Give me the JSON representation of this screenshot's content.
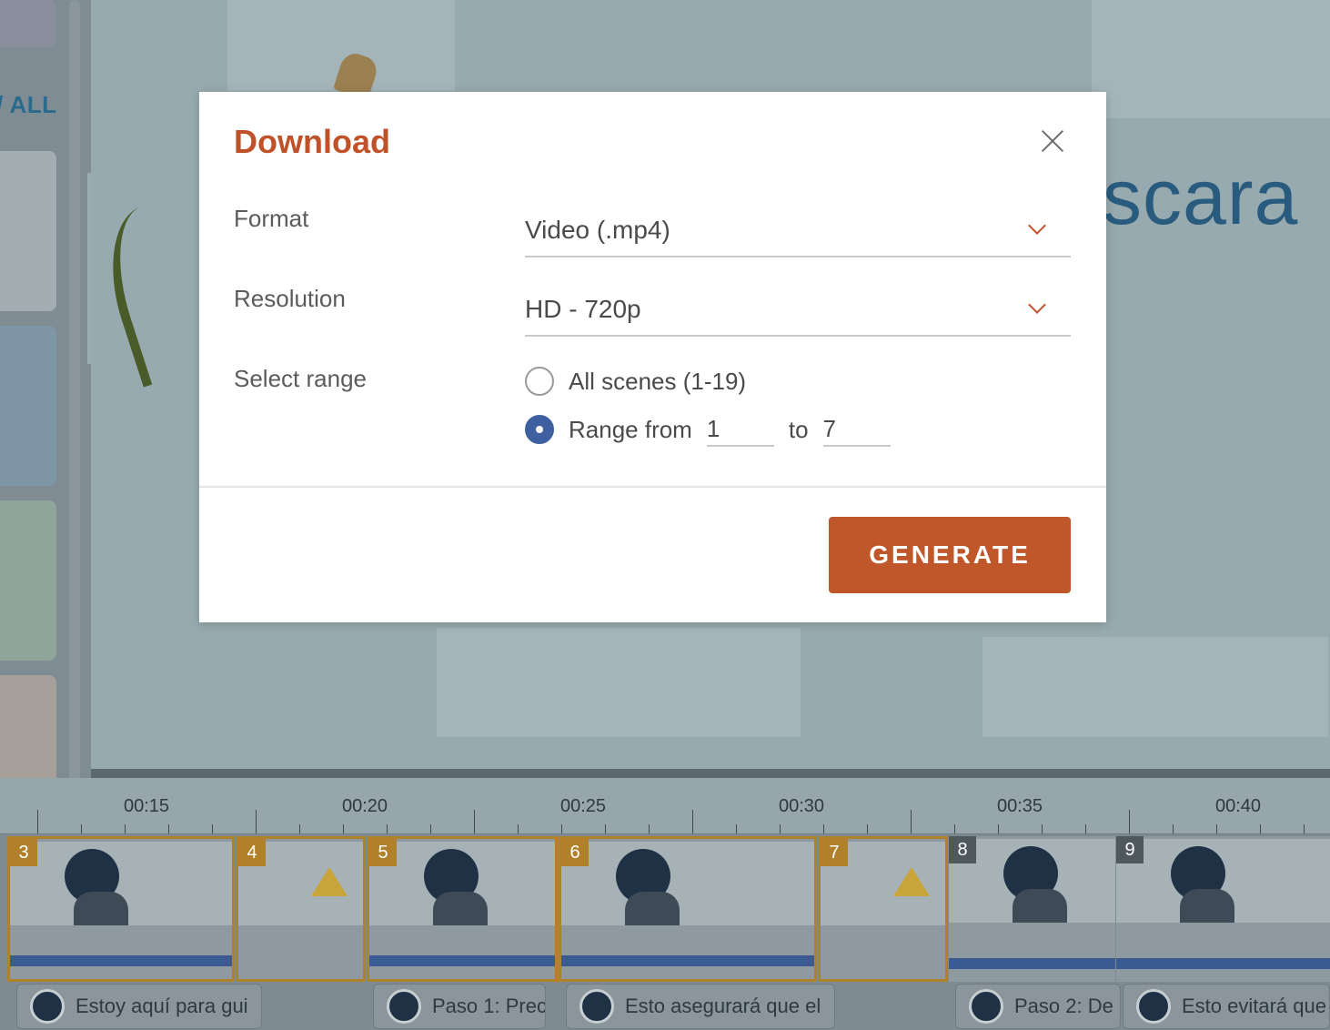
{
  "background": {
    "sidebar": {
      "view_all": "/ ALL"
    },
    "canvas": {
      "word": "scara"
    },
    "timeline": {
      "ticks": [
        "00:15",
        "00:20",
        "00:25",
        "00:30",
        "00:35",
        "00:40"
      ],
      "scenes": [
        "3",
        "4",
        "5",
        "6",
        "7",
        "8",
        "9"
      ],
      "audio_clips": [
        "Estoy aquí para gui",
        "Paso 1: Prec",
        "Esto asegurará que el",
        "Paso 2: De",
        "Esto evitará que"
      ]
    }
  },
  "dialog": {
    "title": "Download",
    "format": {
      "label": "Format",
      "value": "Video (.mp4)"
    },
    "resolution": {
      "label": "Resolution",
      "value": "HD - 720p"
    },
    "range": {
      "label": "Select range",
      "all_scenes": "All scenes (1-19)",
      "range_from": "Range from",
      "from_value": "1",
      "to_label": "to",
      "to_value": "7",
      "selected": "range"
    },
    "generate_label": "GENERATE"
  },
  "colors": {
    "accent": "#c0572a",
    "radio_selected": "#3e5fa0",
    "scene_selected_border": "#b0812a"
  }
}
